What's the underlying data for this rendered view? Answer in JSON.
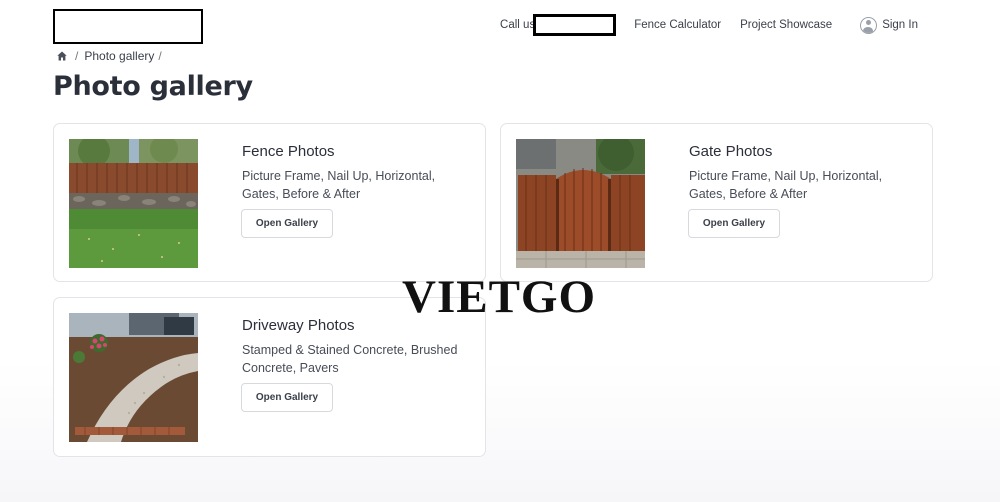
{
  "header": {
    "call_label": "Call us",
    "nav_links": [
      "Fence Calculator",
      "Project Showcase"
    ],
    "signin_label": "Sign In"
  },
  "breadcrumb": {
    "separator": "/",
    "current": "Photo gallery"
  },
  "page_title": "Photo gallery",
  "galleries": [
    {
      "title": "Fence Photos",
      "description": "Picture Frame, Nail Up, Horizontal, Gates, Before & After",
      "button": "Open Gallery"
    },
    {
      "title": "Gate Photos",
      "description": "Picture Frame, Nail Up, Horizontal, Gates, Before & After",
      "button": "Open Gallery"
    },
    {
      "title": "Driveway Photos",
      "description": "Stamped & Stained Concrete, Brushed Concrete, Pavers",
      "button": "Open Gallery"
    }
  ],
  "watermark": "VIETGO"
}
